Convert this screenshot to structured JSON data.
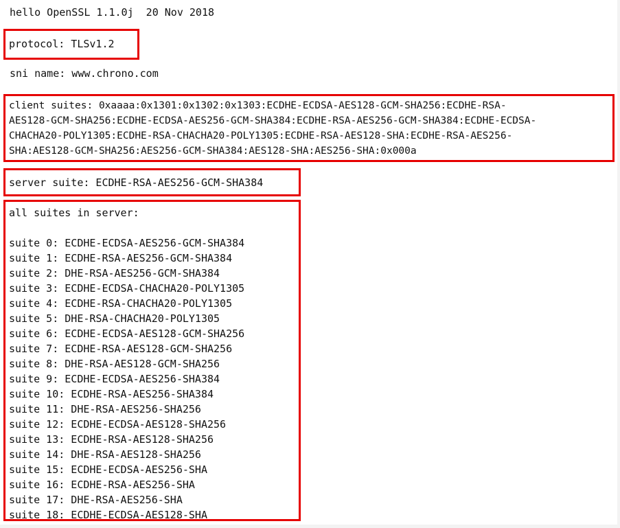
{
  "header": {
    "text": "hello OpenSSL 1.1.0j  20 Nov 2018"
  },
  "protocol": {
    "text": "protocol: TLSv1.2"
  },
  "sni": {
    "text": "sni name: www.chrono.com"
  },
  "client_suites": {
    "lines": [
      "client suites: 0xaaaa:0x1301:0x1302:0x1303:ECDHE-ECDSA-AES128-GCM-SHA256:ECDHE-RSA-",
      "AES128-GCM-SHA256:ECDHE-ECDSA-AES256-GCM-SHA384:ECDHE-RSA-AES256-GCM-SHA384:ECDHE-ECDSA-",
      "CHACHA20-POLY1305:ECDHE-RSA-CHACHA20-POLY1305:ECDHE-RSA-AES128-SHA:ECDHE-RSA-AES256-",
      "SHA:AES128-GCM-SHA256:AES256-GCM-SHA384:AES128-SHA:AES256-SHA:0x000a"
    ]
  },
  "server_suite": {
    "text": "server suite: ECDHE-RSA-AES256-GCM-SHA384"
  },
  "all_suites": {
    "title": "all suites in server:",
    "items": [
      "suite 0: ECDHE-ECDSA-AES256-GCM-SHA384",
      "suite 1: ECDHE-RSA-AES256-GCM-SHA384",
      "suite 2: DHE-RSA-AES256-GCM-SHA384",
      "suite 3: ECDHE-ECDSA-CHACHA20-POLY1305",
      "suite 4: ECDHE-RSA-CHACHA20-POLY1305",
      "suite 5: DHE-RSA-CHACHA20-POLY1305",
      "suite 6: ECDHE-ECDSA-AES128-GCM-SHA256",
      "suite 7: ECDHE-RSA-AES128-GCM-SHA256",
      "suite 8: DHE-RSA-AES128-GCM-SHA256",
      "suite 9: ECDHE-ECDSA-AES256-SHA384",
      "suite 10: ECDHE-RSA-AES256-SHA384",
      "suite 11: DHE-RSA-AES256-SHA256",
      "suite 12: ECDHE-ECDSA-AES128-SHA256",
      "suite 13: ECDHE-RSA-AES128-SHA256",
      "suite 14: DHE-RSA-AES128-SHA256",
      "suite 15: ECDHE-ECDSA-AES256-SHA",
      "suite 16: ECDHE-RSA-AES256-SHA",
      "suite 17: DHE-RSA-AES256-SHA",
      "suite 18: ECDHE-ECDSA-AES128-SHA"
    ]
  },
  "colors": {
    "highlight_border": "#e60000",
    "text": "#111111",
    "page_background": "#ffffff"
  }
}
